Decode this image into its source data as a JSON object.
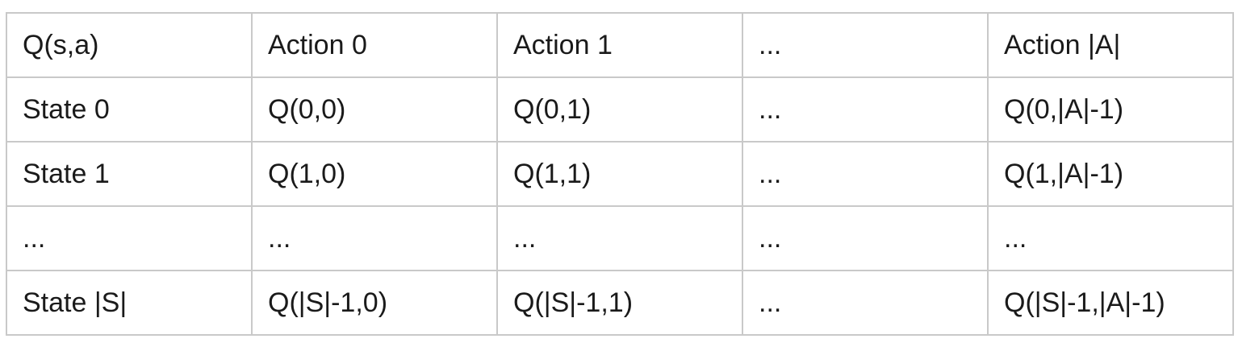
{
  "table": {
    "header": [
      "Q(s,a)",
      "Action 0",
      "Action 1",
      "...",
      "Action |A|"
    ],
    "rows": [
      [
        "State 0",
        "Q(0,0)",
        "Q(0,1)",
        "...",
        "Q(0,|A|-1)"
      ],
      [
        "State 1",
        "Q(1,0)",
        "Q(1,1)",
        "...",
        "Q(1,|A|-1)"
      ],
      [
        "...",
        "...",
        "...",
        "...",
        "..."
      ],
      [
        "State |S|",
        "Q(|S|-1,0)",
        "Q(|S|-1,1)",
        "...",
        "Q(|S|-1,|A|-1)"
      ]
    ]
  }
}
